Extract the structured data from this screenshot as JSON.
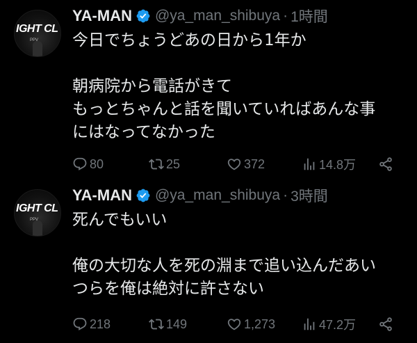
{
  "tweets": [
    {
      "author": {
        "name": "YA-MAN",
        "handle": "@ya_man_shibuya",
        "avatar_text": "IGHT CL",
        "avatar_subtext": "PPV"
      },
      "separator": "·",
      "time": "1時間",
      "lines": [
        "今日でちょうどあの日から1年か",
        "",
        "朝病院から電話がきて",
        "もっとちゃんと話を聞いていればあんな事",
        "にはなってなかった"
      ],
      "stats": {
        "replies": "80",
        "retweets": "25",
        "likes": "372",
        "views": "14.8万"
      }
    },
    {
      "author": {
        "name": "YA-MAN",
        "handle": "@ya_man_shibuya",
        "avatar_text": "IGHT CL",
        "avatar_subtext": "PPV"
      },
      "separator": "·",
      "time": "3時間",
      "lines": [
        "死んでもいい",
        "",
        "俺の大切な人を死の淵まで追い込んだあい",
        "つらを俺は絶対に許さない"
      ],
      "stats": {
        "replies": "218",
        "retweets": "149",
        "likes": "1,273",
        "views": "47.2万"
      }
    }
  ],
  "colors": {
    "background": "#000000",
    "text": "#e7e9ea",
    "muted": "#71767b",
    "verified": "#1d9bf0"
  },
  "icons": [
    "verified-badge-icon",
    "reply-icon",
    "retweet-icon",
    "like-icon",
    "views-icon",
    "share-icon"
  ]
}
